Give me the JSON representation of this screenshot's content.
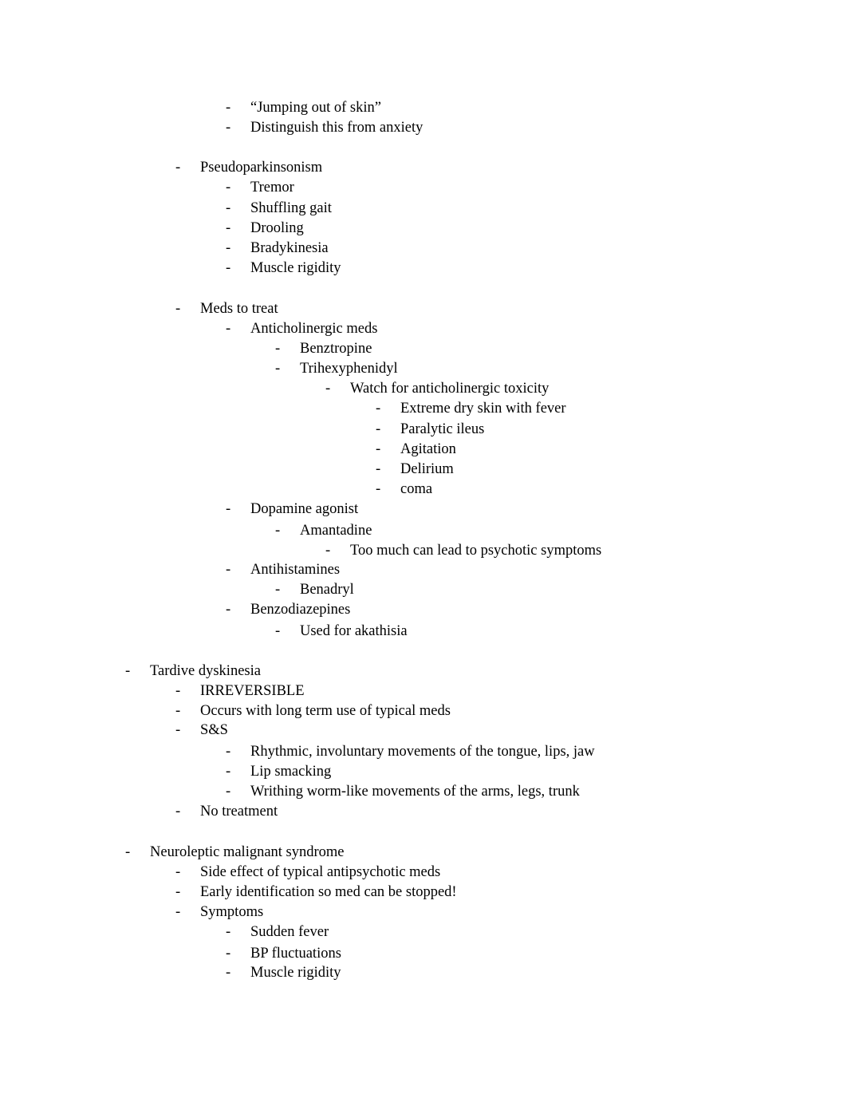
{
  "document": {
    "bullet_glyph": "-",
    "lines": [
      {
        "level": 2,
        "text": "“Jumping out of skin”"
      },
      {
        "level": 2,
        "text": "Distinguish this from anxiety"
      },
      {
        "level": 1,
        "text": "Pseudoparkinsonism"
      },
      {
        "level": 2,
        "text": "Tremor"
      },
      {
        "level": 2,
        "text": "Shuffling gait"
      },
      {
        "level": 2,
        "text": "Drooling"
      },
      {
        "level": 2,
        "text": "Bradykinesia"
      },
      {
        "level": 2,
        "text": "Muscle rigidity"
      },
      {
        "level": 1,
        "text": "Meds to treat"
      },
      {
        "level": 2,
        "text": "Anticholinergic meds"
      },
      {
        "level": 3,
        "text": "Benztropine"
      },
      {
        "level": 3,
        "text": "Trihexyphenidyl"
      },
      {
        "level": 4,
        "text": "Watch for anticholinergic toxicity"
      },
      {
        "level": 5,
        "text": "Extreme dry skin with fever"
      },
      {
        "level": 5,
        "text": "Paralytic ileus"
      },
      {
        "level": 5,
        "text": "Agitation"
      },
      {
        "level": 5,
        "text": "Delirium"
      },
      {
        "level": 5,
        "text": "coma"
      },
      {
        "level": 2,
        "text": "Dopamine agonist"
      },
      {
        "level": 3,
        "text": "Amantadine"
      },
      {
        "level": 4,
        "text": "Too much can lead to psychotic symptoms"
      },
      {
        "level": 2,
        "text": "Antihistamines"
      },
      {
        "level": 3,
        "text": "Benadryl"
      },
      {
        "level": 2,
        "text": "Benzodiazepines"
      },
      {
        "level": 3,
        "text": "Used for akathisia"
      },
      {
        "level": 0,
        "text": "Tardive dyskinesia"
      },
      {
        "level": 1,
        "text": "IRREVERSIBLE"
      },
      {
        "level": 1,
        "text": "Occurs with long term use of typical meds"
      },
      {
        "level": 1,
        "text": "S&S"
      },
      {
        "level": 2,
        "text": "Rhythmic, involuntary movements of the tongue, lips, jaw"
      },
      {
        "level": 2,
        "text": "Lip smacking"
      },
      {
        "level": 2,
        "text": "Writhing worm-like movements of the arms, legs, trunk"
      },
      {
        "level": 1,
        "text": "No treatment"
      },
      {
        "level": 0,
        "text": "Neuroleptic malignant syndrome"
      },
      {
        "level": 1,
        "text": "Side effect of typical antipsychotic meds"
      },
      {
        "level": 1,
        "text": "Early identification so med can be stopped!"
      },
      {
        "level": 1,
        "text": "Symptoms"
      },
      {
        "level": 2,
        "text": "Sudden fever"
      },
      {
        "level": 2,
        "text": "BP fluctuations"
      },
      {
        "level": 2,
        "text": "Muscle rigidity"
      }
    ]
  }
}
